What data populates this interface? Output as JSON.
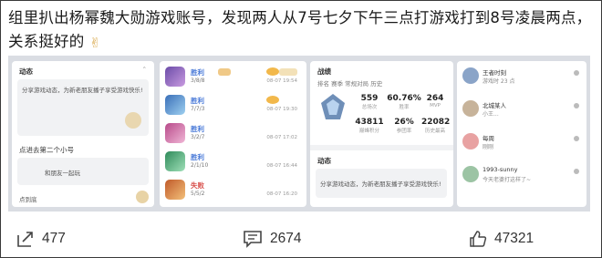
{
  "post": {
    "text_line1": "组里扒出杨幂魏大勋游戏账号，发现两人从7号七夕下午三点打游戏打到8号凌晨两点，",
    "text_line2": "关系挺好的",
    "emoji": "✌"
  },
  "screens": {
    "card1": {
      "title": "动态",
      "line1": "分享游戏动态，为新老朋友播子享受游戏快乐!",
      "section": "点进去第二个小号",
      "sub": "和朋友一起玩",
      "foot": "点到底"
    },
    "card2": {
      "matches": [
        {
          "result": "胜利",
          "kda": "3/8/8",
          "date": "08-07 19:54"
        },
        {
          "result": "胜利",
          "kda": "7/7/3",
          "date": "08-07 19:30"
        },
        {
          "result": "胜利",
          "kda": "3/2/7",
          "date": "08-07 17:02"
        },
        {
          "result": "胜利",
          "kda": "2/1/10",
          "date": "08-07 16:44"
        },
        {
          "result": "失败",
          "kda": "5/5/2",
          "date": "08-07 16:20"
        }
      ]
    },
    "card3": {
      "title": "战绩",
      "tabs": "排名  赛季  常规对局  历史",
      "stats": [
        {
          "value": "559",
          "label": "总场次"
        },
        {
          "value": "60.76%",
          "label": "胜率"
        },
        {
          "value": "264",
          "label": "MVP"
        },
        {
          "value": "43811",
          "label": "巅峰积分"
        },
        {
          "value": "26%",
          "label": "参团率"
        },
        {
          "value": "22082",
          "label": "历史最高"
        }
      ],
      "section": "动态",
      "line1": "分享游戏动态，为新老朋友播子享受游戏快乐!"
    },
    "card4": {
      "friends": [
        {
          "name": "王者时刻",
          "sub": "游戏时 23 点"
        },
        {
          "name": "北城某人",
          "sub": "小王..."
        },
        {
          "name": "每周",
          "sub": "刚刚"
        },
        {
          "name": "1993-sunny",
          "sub": "今天老婆打这样了~"
        }
      ]
    }
  },
  "actions": {
    "share_count": "477",
    "comment_count": "2674",
    "like_count": "47321"
  },
  "colors": {
    "win": "#4a7ad8",
    "loss": "#d9534f",
    "strip_bg": "#dadde3"
  }
}
